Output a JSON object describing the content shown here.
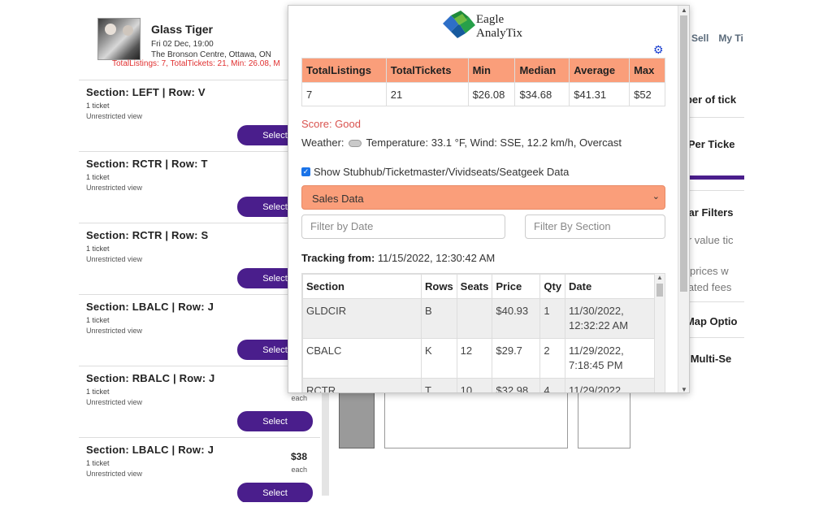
{
  "event": {
    "title": "Glass Tiger",
    "date": "Fri 02 Dec, 19:00",
    "venue": "The Bronson Centre, Ottawa, ON",
    "summary": "TotalListings: 7, TotalTickets: 21, Min: 26.08, M"
  },
  "listings": [
    {
      "title": "Section: LEFT | Row: V",
      "qty": "1 ticket",
      "view": "Unrestricted view",
      "price": "",
      "each": "",
      "button": "Select"
    },
    {
      "title": "Section: RCTR | Row: T",
      "qty": "1 ticket",
      "view": "Unrestricted view",
      "price": "",
      "each": "",
      "button": "Select"
    },
    {
      "title": "Section: RCTR | Row: S",
      "qty": "1 ticket",
      "view": "Unrestricted view",
      "price": "",
      "each": "",
      "button": "Select"
    },
    {
      "title": "Section: LBALC | Row: J",
      "qty": "1 ticket",
      "view": "Unrestricted view",
      "price": "",
      "each": "",
      "button": "Select"
    },
    {
      "title": "Section: RBALC | Row: J",
      "qty": "1 ticket",
      "view": "Unrestricted view",
      "price": "",
      "each": "each",
      "button": "Select"
    },
    {
      "title": "Section: LBALC | Row: J",
      "qty": "1 ticket",
      "view": "Unrestricted view",
      "price": "$38",
      "each": "each",
      "button": "Select"
    }
  ],
  "top_nav": {
    "sell": "Sell",
    "my_tickets": "My Ti"
  },
  "right_panel": {
    "number_of_tickets": "nber of tick",
    "price_per_ticket": "e Per Ticke",
    "popular_filters": "ular Filters",
    "better_value": "ter value tic",
    "show_prices": "w prices w",
    "estimated_fees": "mated fees",
    "map_options": "t Map Optio",
    "multi_select": "w Multi-Se"
  },
  "popup": {
    "logo_line1": "Eagle",
    "logo_line2": "AnalyTix",
    "stats_headers": [
      "TotalListings",
      "TotalTickets",
      "Min",
      "Median",
      "Average",
      "Max"
    ],
    "stats_values": [
      "7",
      "21",
      "$26.08",
      "$34.68",
      "$41.31",
      "$52"
    ],
    "score": "Score: Good",
    "weather": "Weather:",
    "weather_detail": "Temperature: 33.1 °F, Wind: SSE, 12.2 km/h, Overcast",
    "show_data_label": "Show Stubhub/Ticketmaster/Vividseats/Seatgeek Data",
    "dropdown_label": "Sales Data",
    "filter_date_placeholder": "Filter by Date",
    "filter_section_placeholder": "Filter By Section",
    "tracking_label": "Tracking from:",
    "tracking_value": "11/15/2022, 12:30:42 AM",
    "sales_headers": [
      "Section",
      "Rows",
      "Seats",
      "Price",
      "Qty",
      "Date"
    ],
    "sales_rows": [
      {
        "section": "GLDCIR",
        "rows": "B",
        "seats": "",
        "price": "$40.93",
        "qty": "1",
        "date1": "11/30/2022,",
        "date2": "12:32:22 AM"
      },
      {
        "section": "CBALC",
        "rows": "K",
        "seats": "12",
        "price": "$29.7",
        "qty": "2",
        "date1": "11/29/2022,",
        "date2": "7:18:45 PM"
      },
      {
        "section": "RCTR",
        "rows": "T",
        "seats": "10",
        "price": "$32.98",
        "qty": "4",
        "date1": "11/29/2022,",
        "date2": ""
      }
    ]
  }
}
